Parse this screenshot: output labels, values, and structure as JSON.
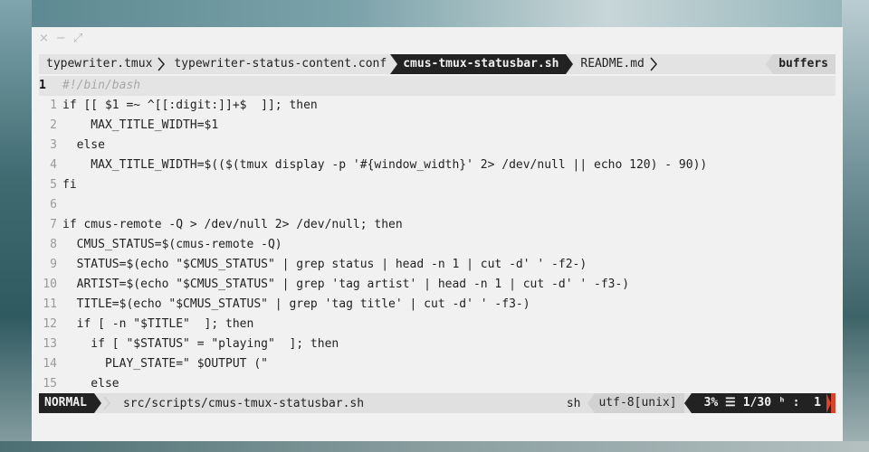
{
  "window_controls": [
    "×",
    "−",
    "⤢"
  ],
  "tabs": [
    {
      "label": "typewriter.tmux",
      "active": false
    },
    {
      "label": "typewriter-status-content.conf",
      "active": false
    },
    {
      "label": "cmus-tmux-statusbar.sh",
      "active": true
    },
    {
      "label": "README.md",
      "active": false
    }
  ],
  "buffers_label": "buffers",
  "code": {
    "lines": [
      {
        "num": "1",
        "text": "#!/bin/bash"
      },
      {
        "num": "1",
        "text": "if [[ $1 =~ ^[[:digit:]]+$  ]]; then"
      },
      {
        "num": "2",
        "text": "    MAX_TITLE_WIDTH=$1"
      },
      {
        "num": "3",
        "text": "  else"
      },
      {
        "num": "4",
        "text": "    MAX_TITLE_WIDTH=$(($(tmux display -p '#{window_width}' 2> /dev/null || echo 120) - 90))"
      },
      {
        "num": "5",
        "text": "fi"
      },
      {
        "num": "6",
        "text": ""
      },
      {
        "num": "7",
        "text": "if cmus-remote -Q > /dev/null 2> /dev/null; then"
      },
      {
        "num": "8",
        "text": "  CMUS_STATUS=$(cmus-remote -Q)"
      },
      {
        "num": "9",
        "text": "  STATUS=$(echo \"$CMUS_STATUS\" | grep status | head -n 1 | cut -d' ' -f2-)"
      },
      {
        "num": "10",
        "text": "  ARTIST=$(echo \"$CMUS_STATUS\" | grep 'tag artist' | head -n 1 | cut -d' ' -f3-)"
      },
      {
        "num": "11",
        "text": "  TITLE=$(echo \"$CMUS_STATUS\" | grep 'tag title' | cut -d' ' -f3-)"
      },
      {
        "num": "12",
        "text": "  if [ -n \"$TITLE\"  ]; then"
      },
      {
        "num": "13",
        "text": "    if [ \"$STATUS\" = \"playing\"  ]; then"
      },
      {
        "num": "14",
        "text": "      PLAY_STATE=\" $OUTPUT (\""
      },
      {
        "num": "15",
        "text": "    else"
      }
    ]
  },
  "statusline": {
    "mode": "NORMAL",
    "filepath": "src/scripts/cmus-tmux-statusbar.sh",
    "filetype": "sh",
    "encoding": "utf-8[unix]",
    "percent": "3% ☰",
    "position": "1/30",
    "column": "ʰ :  1"
  },
  "colors": {
    "accent_dark": "#222222",
    "warning": "#d9432b"
  }
}
